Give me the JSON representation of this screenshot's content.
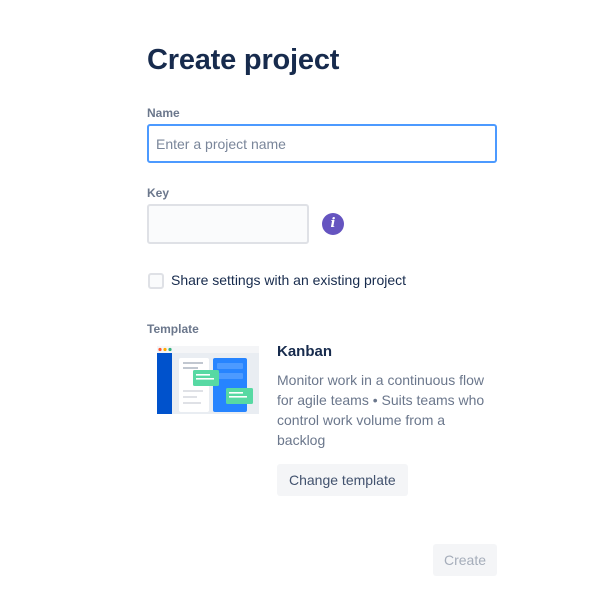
{
  "page": {
    "title": "Create project"
  },
  "form": {
    "name": {
      "label": "Name",
      "value": "",
      "placeholder": "Enter a project name"
    },
    "key": {
      "label": "Key",
      "value": "",
      "placeholder": "",
      "info_icon": "info-icon"
    },
    "share_settings": {
      "label": "Share settings with an existing project",
      "checked": false
    }
  },
  "template": {
    "section_label": "Template",
    "name": "Kanban",
    "description": "Monitor work in a continuous flow for agile teams • Suits teams who control work volume from a backlog",
    "change_button_label": "Change template"
  },
  "actions": {
    "create_label": "Create",
    "create_enabled": false
  },
  "colors": {
    "accent": "#4c9aff",
    "info": "#6554c0",
    "heading": "#172b4d",
    "muted": "#6b778c"
  }
}
